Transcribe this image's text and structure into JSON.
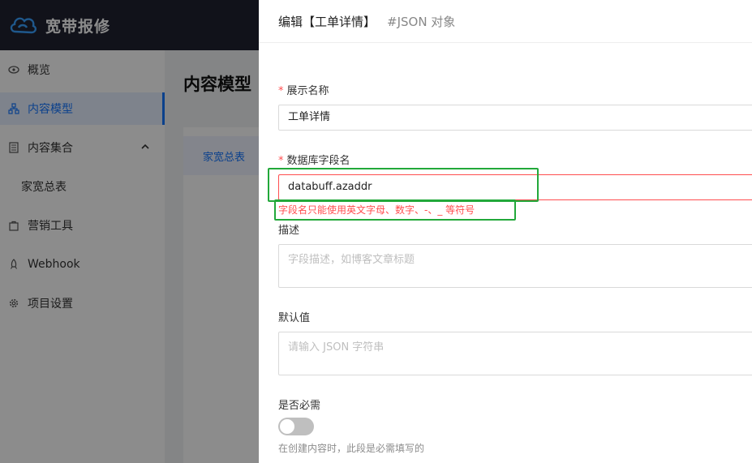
{
  "header": {
    "brand": "宽带报修"
  },
  "sidebar": {
    "items": [
      {
        "label": "概览",
        "icon": "eye-icon"
      },
      {
        "label": "内容模型",
        "icon": "model-icon",
        "active": true
      },
      {
        "label": "内容集合",
        "icon": "collection-icon",
        "expanded": true
      },
      {
        "label": "家宽总表",
        "sub": true
      },
      {
        "label": "营销工具",
        "icon": "bag-icon"
      },
      {
        "label": "Webhook",
        "icon": "rocket-icon"
      },
      {
        "label": "项目设置",
        "icon": "gear-icon"
      }
    ]
  },
  "main": {
    "title": "内容模型",
    "tab_label": "家宽总表"
  },
  "drawer": {
    "title": "编辑【工单详情】",
    "subtitle": "#JSON 对象",
    "fields": {
      "display_name": {
        "label": "展示名称",
        "required": true,
        "value": "工单详情"
      },
      "db_field": {
        "label": "数据库字段名",
        "required": true,
        "value": "databuff.azaddr",
        "error": "字段名只能使用英文字母、数字、-、_ 等符号"
      },
      "description": {
        "label": "描述",
        "placeholder": "字段描述，如博客文章标题"
      },
      "default_value": {
        "label": "默认值",
        "placeholder": "请输入 JSON 字符串"
      },
      "required_toggle": {
        "label": "是否必需",
        "on": false,
        "hint": "在创建内容时，此段是必需填写的"
      }
    }
  },
  "colors": {
    "accent": "#1677ff",
    "error": "#ff4d4f",
    "highlight": "#22a83a",
    "topbar": "#1f2230"
  }
}
